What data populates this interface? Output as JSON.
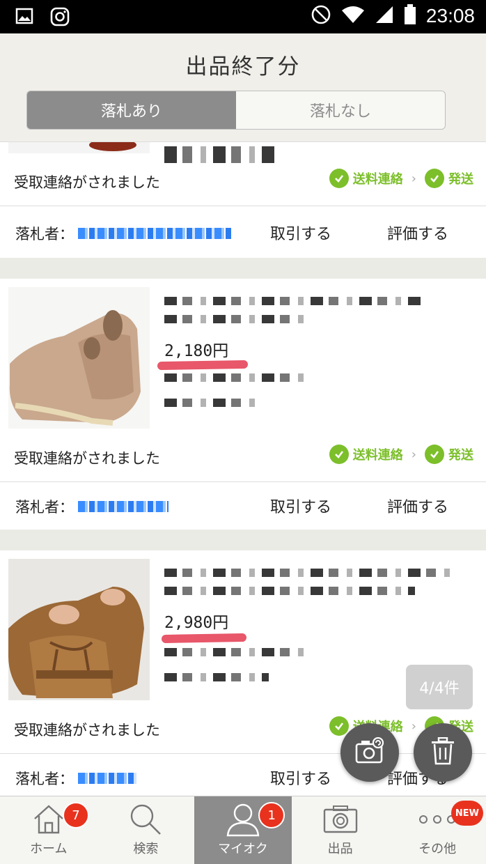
{
  "status_bar": {
    "time": "23:08"
  },
  "header": {
    "title": "出品終了分"
  },
  "segments": {
    "active": "落札あり",
    "inactive": "落札なし"
  },
  "items": [
    {
      "status_message": "受取連絡がされました",
      "step1": "送料連絡",
      "step2": "発送",
      "bidder_label": "落札者：",
      "action_trade": "取引する",
      "action_rate": "評価する"
    },
    {
      "price": "2,180円",
      "status_message": "受取連絡がされました",
      "step1": "送料連絡",
      "step2": "発送",
      "bidder_label": "落札者：",
      "action_trade": "取引する",
      "action_rate": "評価する"
    },
    {
      "price": "2,980円",
      "status_message": "受取連絡がされました",
      "step1": "送料連絡",
      "step2": "発送",
      "bidder_label": "落札者：",
      "action_trade": "取引する",
      "action_rate": "評価する"
    }
  ],
  "pager": "4/4件",
  "nav": [
    {
      "label": "ホーム",
      "badge": "7",
      "icon": "home-icon"
    },
    {
      "label": "検索",
      "icon": "search-icon"
    },
    {
      "label": "マイオク",
      "badge": "1",
      "icon": "user-icon"
    },
    {
      "label": "出品",
      "icon": "camera-icon"
    },
    {
      "label": "その他",
      "badge": "NEW",
      "icon": "more-icon"
    }
  ],
  "colors": {
    "accent_green": "#7cbf2a",
    "badge_red": "#e8321e",
    "active_tab": "#8c8c8c"
  }
}
